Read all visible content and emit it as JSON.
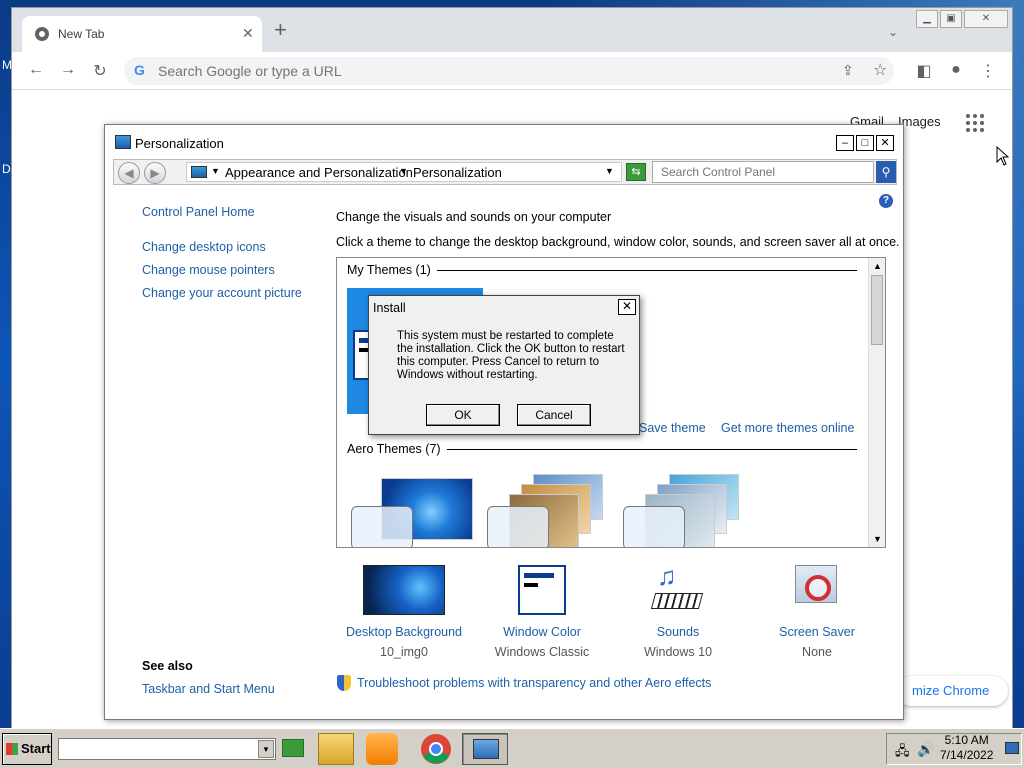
{
  "desktop": {
    "left_text_1": "M",
    "left_text_2": "D"
  },
  "browser": {
    "tab_title": "New Tab",
    "new_tab_symbol": "+",
    "address_placeholder": "Search Google or type a URL",
    "ntp_links": [
      "Gmail",
      "Images"
    ],
    "customize_label": "mize Chrome"
  },
  "personalization": {
    "window_title": "Personalization",
    "breadcrumbs": [
      "Appearance and Personalization",
      "Personalization"
    ],
    "search_placeholder": "Search Control Panel",
    "sidebar_links": [
      "Control Panel Home",
      "Change desktop icons",
      "Change mouse pointers",
      "Change your account picture"
    ],
    "heading": "Change the visuals and sounds on your computer",
    "subheading": "Click a theme to change the desktop background, window color, sounds, and screen saver all at once.",
    "my_themes_header": "My Themes (1)",
    "save_theme": "Save theme",
    "get_more_themes": "Get more themes online",
    "aero_themes_header": "Aero Themes (7)",
    "bottom_items": [
      {
        "label": "Desktop Background",
        "value": "10_img0"
      },
      {
        "label": "Window Color",
        "value": "Windows Classic"
      },
      {
        "label": "Sounds",
        "value": "Windows 10"
      },
      {
        "label": "Screen Saver",
        "value": "None"
      }
    ],
    "see_also": "See also",
    "see_also_links": [
      "Taskbar and Start Menu"
    ],
    "troubleshoot_link": "Troubleshoot problems with transparency and other Aero effects"
  },
  "dialog": {
    "title": "Install",
    "message": "This system must be restarted to complete the installation. Click the OK button to restart this computer. Press Cancel to return to Windows without restarting.",
    "ok_label": "OK",
    "cancel_label": "Cancel"
  },
  "taskbar": {
    "start_label": "Start",
    "time": "5:10 AM",
    "date": "7/14/2022"
  }
}
